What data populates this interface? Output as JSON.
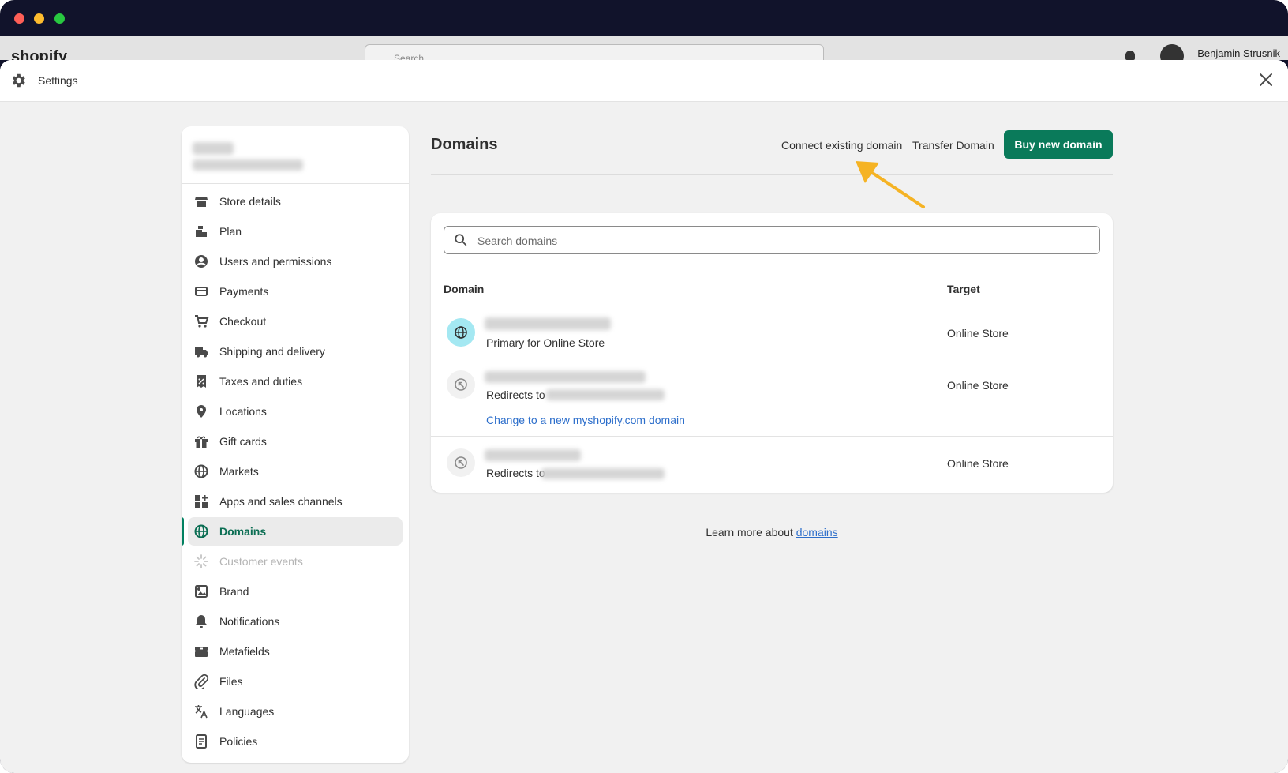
{
  "window": {
    "traffic_lights": [
      "close",
      "minimize",
      "zoom"
    ]
  },
  "admin_bar": {
    "logo": "shopify",
    "search_placeholder": "Search",
    "user": "Benjamin Strusnik"
  },
  "header": {
    "title": "Settings"
  },
  "sidebar": {
    "items": [
      {
        "label": "Store details",
        "icon": "store-icon"
      },
      {
        "label": "Plan",
        "icon": "plan-icon"
      },
      {
        "label": "Users and permissions",
        "icon": "user-icon"
      },
      {
        "label": "Payments",
        "icon": "payments-icon"
      },
      {
        "label": "Checkout",
        "icon": "cart-icon"
      },
      {
        "label": "Shipping and delivery",
        "icon": "truck-icon"
      },
      {
        "label": "Taxes and duties",
        "icon": "receipt-icon"
      },
      {
        "label": "Locations",
        "icon": "location-pin-icon"
      },
      {
        "label": "Gift cards",
        "icon": "gift-icon"
      },
      {
        "label": "Markets",
        "icon": "globe-icon"
      },
      {
        "label": "Apps and sales channels",
        "icon": "apps-icon"
      },
      {
        "label": "Domains",
        "icon": "domain-globe-icon",
        "active": true
      },
      {
        "label": "Customer events",
        "icon": "sparkle-icon",
        "disabled": true
      },
      {
        "label": "Brand",
        "icon": "brand-icon"
      },
      {
        "label": "Notifications",
        "icon": "bell-icon"
      },
      {
        "label": "Metafields",
        "icon": "metafields-icon"
      },
      {
        "label": "Files",
        "icon": "paperclip-icon"
      },
      {
        "label": "Languages",
        "icon": "translate-icon"
      },
      {
        "label": "Policies",
        "icon": "policy-icon"
      }
    ]
  },
  "main": {
    "title": "Domains",
    "connect_label": "Connect existing domain",
    "transfer_label": "Transfer Domain",
    "buy_label": "Buy new domain",
    "search_placeholder": "Search domains",
    "columns": {
      "domain": "Domain",
      "target": "Target"
    },
    "rows": [
      {
        "subtitle": "Primary for Online Store",
        "target": "Online Store"
      },
      {
        "subtitle": "Redirects to",
        "target": "Online Store",
        "link": "Change to a new myshopify.com domain"
      },
      {
        "subtitle": "Redirects to",
        "target": "Online Store"
      }
    ],
    "learn_prefix": "Learn more about ",
    "learn_link": "domains"
  },
  "colors": {
    "primary": "#0a7a5a",
    "link": "#2c6ecb",
    "annotation_arrow": "#f5b324",
    "background": "#f1f1f1"
  }
}
